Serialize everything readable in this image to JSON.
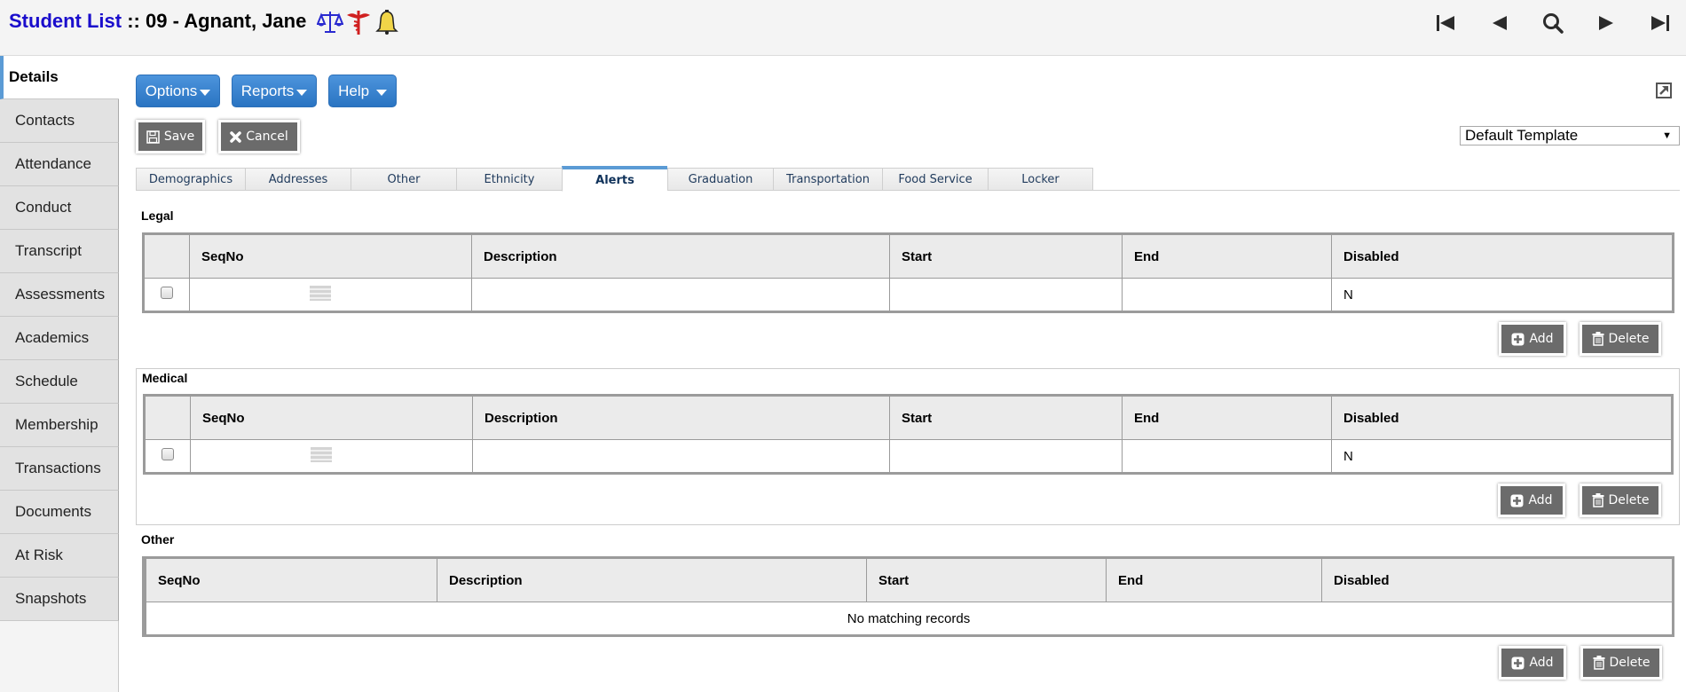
{
  "header": {
    "title_link": "Student List",
    "title_separator": " :: ",
    "student": "09 - Agnant, Jane",
    "alert_icons": [
      "legal-scales-icon",
      "medical-caduceus-icon",
      "bell-icon"
    ],
    "nav": [
      "first-record-icon",
      "previous-record-icon",
      "search-icon",
      "next-record-icon",
      "last-record-icon"
    ]
  },
  "sidebar": {
    "items": [
      {
        "label": "Details",
        "active": true
      },
      {
        "label": "Contacts"
      },
      {
        "label": "Attendance"
      },
      {
        "label": "Conduct"
      },
      {
        "label": "Transcript"
      },
      {
        "label": "Assessments"
      },
      {
        "label": "Academics"
      },
      {
        "label": "Schedule"
      },
      {
        "label": "Membership"
      },
      {
        "label": "Transactions"
      },
      {
        "label": "Documents"
      },
      {
        "label": "At Risk"
      },
      {
        "label": "Snapshots"
      }
    ]
  },
  "toolbar": {
    "options_label": "Options",
    "reports_label": "Reports",
    "help_label": "Help",
    "save_label": "Save",
    "cancel_label": "Cancel",
    "template_selected": "Default Template"
  },
  "tabs": [
    {
      "label": "Demographics"
    },
    {
      "label": "Addresses"
    },
    {
      "label": "Other"
    },
    {
      "label": "Ethnicity"
    },
    {
      "label": "Alerts",
      "active": true
    },
    {
      "label": "Graduation"
    },
    {
      "label": "Transportation"
    },
    {
      "label": "Food Service"
    },
    {
      "label": "Locker"
    }
  ],
  "sections": {
    "legal": {
      "label": "Legal",
      "columns": [
        "",
        "SeqNo",
        "Description",
        "Start",
        "End",
        "Disabled"
      ],
      "rows": [
        {
          "seqno": "",
          "description": "",
          "start": "",
          "end": "",
          "disabled": "N"
        }
      ],
      "add_label": "Add",
      "delete_label": "Delete"
    },
    "medical": {
      "label": "Medical",
      "columns": [
        "",
        "SeqNo",
        "Description",
        "Start",
        "End",
        "Disabled"
      ],
      "rows": [
        {
          "seqno": "",
          "description": "",
          "start": "",
          "end": "",
          "disabled": "N"
        }
      ],
      "add_label": "Add",
      "delete_label": "Delete"
    },
    "other": {
      "label": "Other",
      "columns": [
        "SeqNo",
        "Description",
        "Start",
        "End",
        "Disabled"
      ],
      "empty_message": "No matching records",
      "add_label": "Add",
      "delete_label": "Delete"
    }
  },
  "colors": {
    "title_link": "#1a0dcc",
    "primary_button": "#2a74c2",
    "secondary_button": "#6b6b6b",
    "active_accent": "#5b9bd5"
  }
}
